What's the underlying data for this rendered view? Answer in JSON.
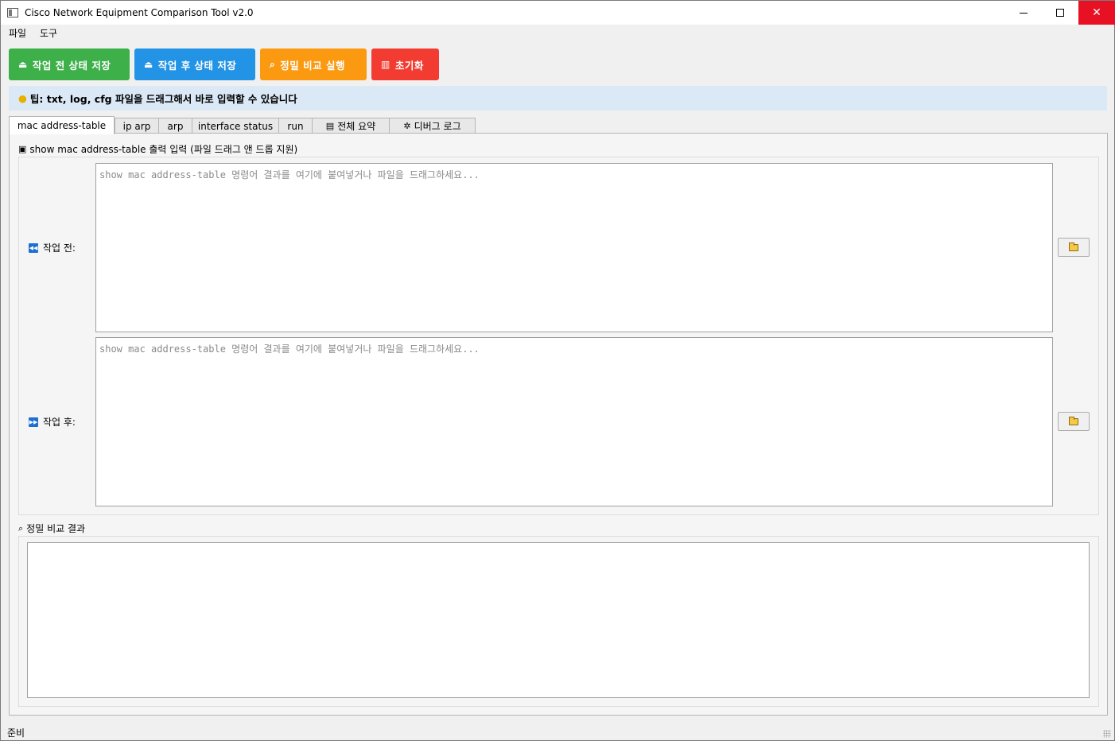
{
  "window": {
    "title": "Cisco Network Equipment Comparison Tool v2.0",
    "close_glyph": "✕"
  },
  "menu": [
    "파일",
    "도구"
  ],
  "toolbar": {
    "before_label": "작업 전 상태 저장",
    "after_label": "작업 후 상태 저장",
    "compare_label": "정밀 비교 실행",
    "reset_label": "초기화"
  },
  "tip": "팁: txt, log, cfg 파일을 드래그해서 바로 입력할 수 있습니다",
  "tabs": [
    {
      "label": "mac address-table",
      "active": true
    },
    {
      "label": "ip arp"
    },
    {
      "label": "arp"
    },
    {
      "label": "interface status"
    },
    {
      "label": "run"
    },
    {
      "label": "전체 요약",
      "icon": "chart-icon"
    },
    {
      "label": "디버그 로그",
      "icon": "bug-icon"
    }
  ],
  "input_section": {
    "title": "show mac address-table 출력 입력 (파일 드래그 앤 드롭 지원)",
    "before_label": "작업 전:",
    "after_label": "작업 후:",
    "placeholder": "show mac address-table 명령어 결과를 여기에 붙여넣거나 파일을 드래그하세요..."
  },
  "result_section": {
    "title": "정밀 비교 결과"
  },
  "status": "준비",
  "colors": {
    "before_button": "#3db04a",
    "after_button": "#2393e6",
    "compare_button": "#fb9a11",
    "reset_button": "#f23c32",
    "tip_background": "#dbe9f6"
  }
}
